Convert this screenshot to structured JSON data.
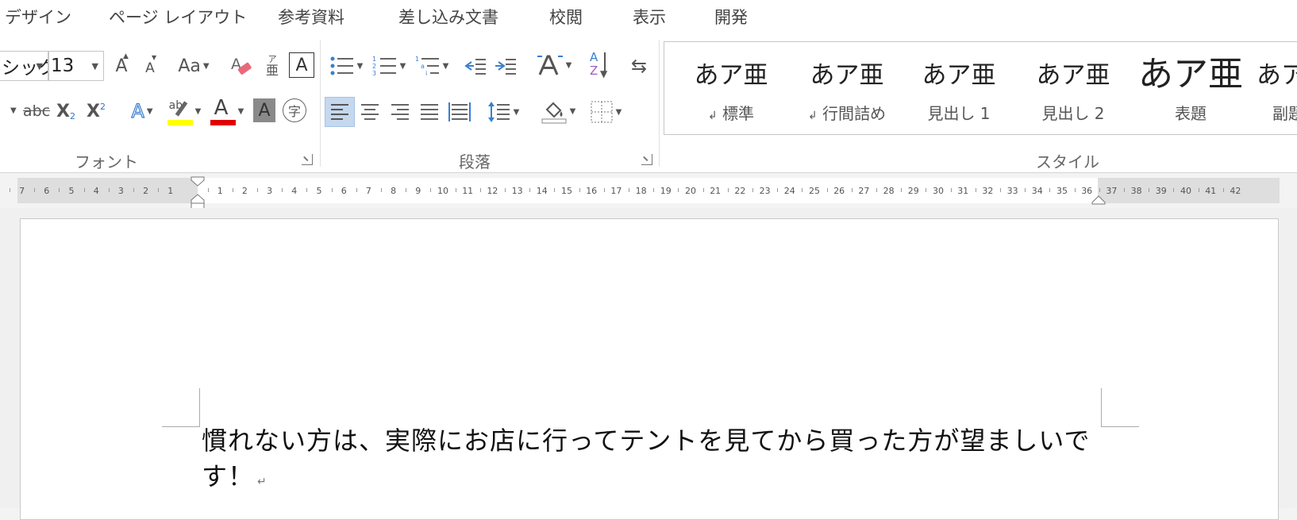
{
  "tabs": [
    "デザイン",
    "ページ レイアウト",
    "参考資料",
    "差し込み文書",
    "校閲",
    "表示",
    "開発"
  ],
  "font": {
    "name_value": "シック",
    "size_value": "13",
    "group_label": "フォント",
    "change_case_label": "Aa",
    "phonetic_top": "ア",
    "phonetic_bottom": "亜",
    "char_border_glyph": "A",
    "grow_glyph": "A",
    "shrink_glyph": "A",
    "strike_label": "abc",
    "subscript_label": "X",
    "subscript_mark": "2",
    "superscript_label": "X",
    "superscript_mark": "2",
    "text_effect_glyph": "A",
    "highlight_glyph": "ab",
    "font_color_glyph": "A",
    "shading_glyph": "A",
    "enclose_glyph": "字",
    "highlight_color": "#ffff00",
    "font_color": "#e00000"
  },
  "paragraph": {
    "group_label": "段落",
    "sort_top": "A",
    "sort_bottom": "Z"
  },
  "styles": {
    "group_label": "スタイル",
    "items": [
      {
        "sample": "あア亜",
        "name": "標準",
        "mark": "↲"
      },
      {
        "sample": "あア亜",
        "name": "行間詰め",
        "mark": "↲"
      },
      {
        "sample": "あア亜",
        "name": "見出し 1",
        "mark": ""
      },
      {
        "sample": "あア亜",
        "name": "見出し 2",
        "mark": ""
      },
      {
        "sample": "あア亜",
        "name": "表題",
        "mark": ""
      },
      {
        "sample": "あア",
        "name": "副題",
        "mark": ""
      }
    ]
  },
  "ruler": {
    "left_numbers": [
      "7",
      "6",
      "5",
      "4",
      "3",
      "2",
      "1"
    ],
    "right_numbers": [
      "1",
      "2",
      "3",
      "4",
      "5",
      "6",
      "7",
      "8",
      "9",
      "10",
      "11",
      "12",
      "13",
      "14",
      "15",
      "16",
      "17",
      "18",
      "19",
      "20",
      "21",
      "22",
      "23",
      "24",
      "25",
      "26",
      "27",
      "28",
      "29",
      "30",
      "31",
      "32",
      "33",
      "34",
      "35",
      "36",
      "37",
      "38",
      "39",
      "40",
      "41",
      "42"
    ]
  },
  "document": {
    "text": "慣れない方は、実際にお店に行ってテントを見てから買った方が望ましいです！",
    "paragraph_mark": "↵"
  }
}
